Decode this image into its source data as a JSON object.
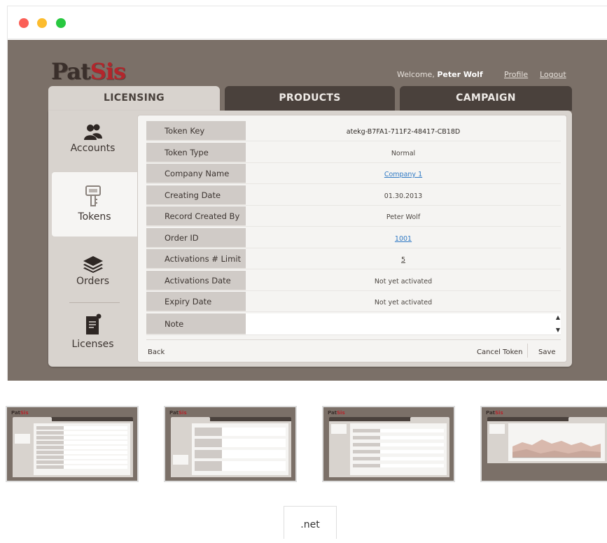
{
  "window": {
    "controls": [
      "close",
      "minimize",
      "zoom"
    ]
  },
  "header": {
    "logo_part1": "Pat",
    "logo_part2": "Sis",
    "welcome_prefix": "Welcome,",
    "user_name": "Peter Wolf",
    "profile_link": "Profile",
    "logout_link": "Logout"
  },
  "tabs": [
    {
      "label": "LICENSING",
      "active": true
    },
    {
      "label": "PRODUCTS",
      "active": false
    },
    {
      "label": "CAMPAIGN",
      "active": false
    }
  ],
  "sidebar": {
    "items": [
      {
        "label": "Accounts",
        "icon": "users-icon",
        "active": false
      },
      {
        "label": "Tokens",
        "icon": "key-icon",
        "active": true
      },
      {
        "label": "Orders",
        "icon": "layers-icon",
        "active": false
      },
      {
        "label": "Licenses",
        "icon": "license-document-icon",
        "active": false
      }
    ]
  },
  "token": {
    "fields": [
      {
        "label": "Token Key",
        "value": "atekg-B7FA1-711F2-48417-CB18D",
        "style": "bold"
      },
      {
        "label": "Token Type",
        "value": "Normal",
        "style": "plain"
      },
      {
        "label": "Company Name",
        "value": "Company 1",
        "style": "link"
      },
      {
        "label": "Creating Date",
        "value": "01.30.2013",
        "style": "plain"
      },
      {
        "label": "Record Created By",
        "value": "Peter Wolf",
        "style": "plain"
      },
      {
        "label": "Order ID",
        "value": "1001",
        "style": "link"
      },
      {
        "label": "Activations # Limit",
        "value": "5",
        "style": "underline"
      },
      {
        "label": "Activations Date",
        "value": "Not yet activated",
        "style": "plain"
      },
      {
        "label": "Expiry Date",
        "value": "Not yet activated",
        "style": "plain"
      },
      {
        "label": "Note",
        "value": "",
        "style": "input"
      }
    ],
    "back_label": "Back",
    "cancel_label": "Cancel Token",
    "save_label": "Save"
  },
  "thumbnails": [
    {
      "name": "tokens-screen",
      "active_tab": 0
    },
    {
      "name": "products-screen",
      "active_tab": 0
    },
    {
      "name": "campaign-form-screen",
      "active_tab": 2
    },
    {
      "name": "campaign-chart-screen",
      "active_tab": 2
    }
  ],
  "tech_tag": ".net",
  "colors": {
    "background": "#7b7068",
    "panel": "#d8d3ce",
    "tab_inactive": "#4a413c",
    "link": "#2f79c4",
    "logo_accent": "#b3262c"
  }
}
